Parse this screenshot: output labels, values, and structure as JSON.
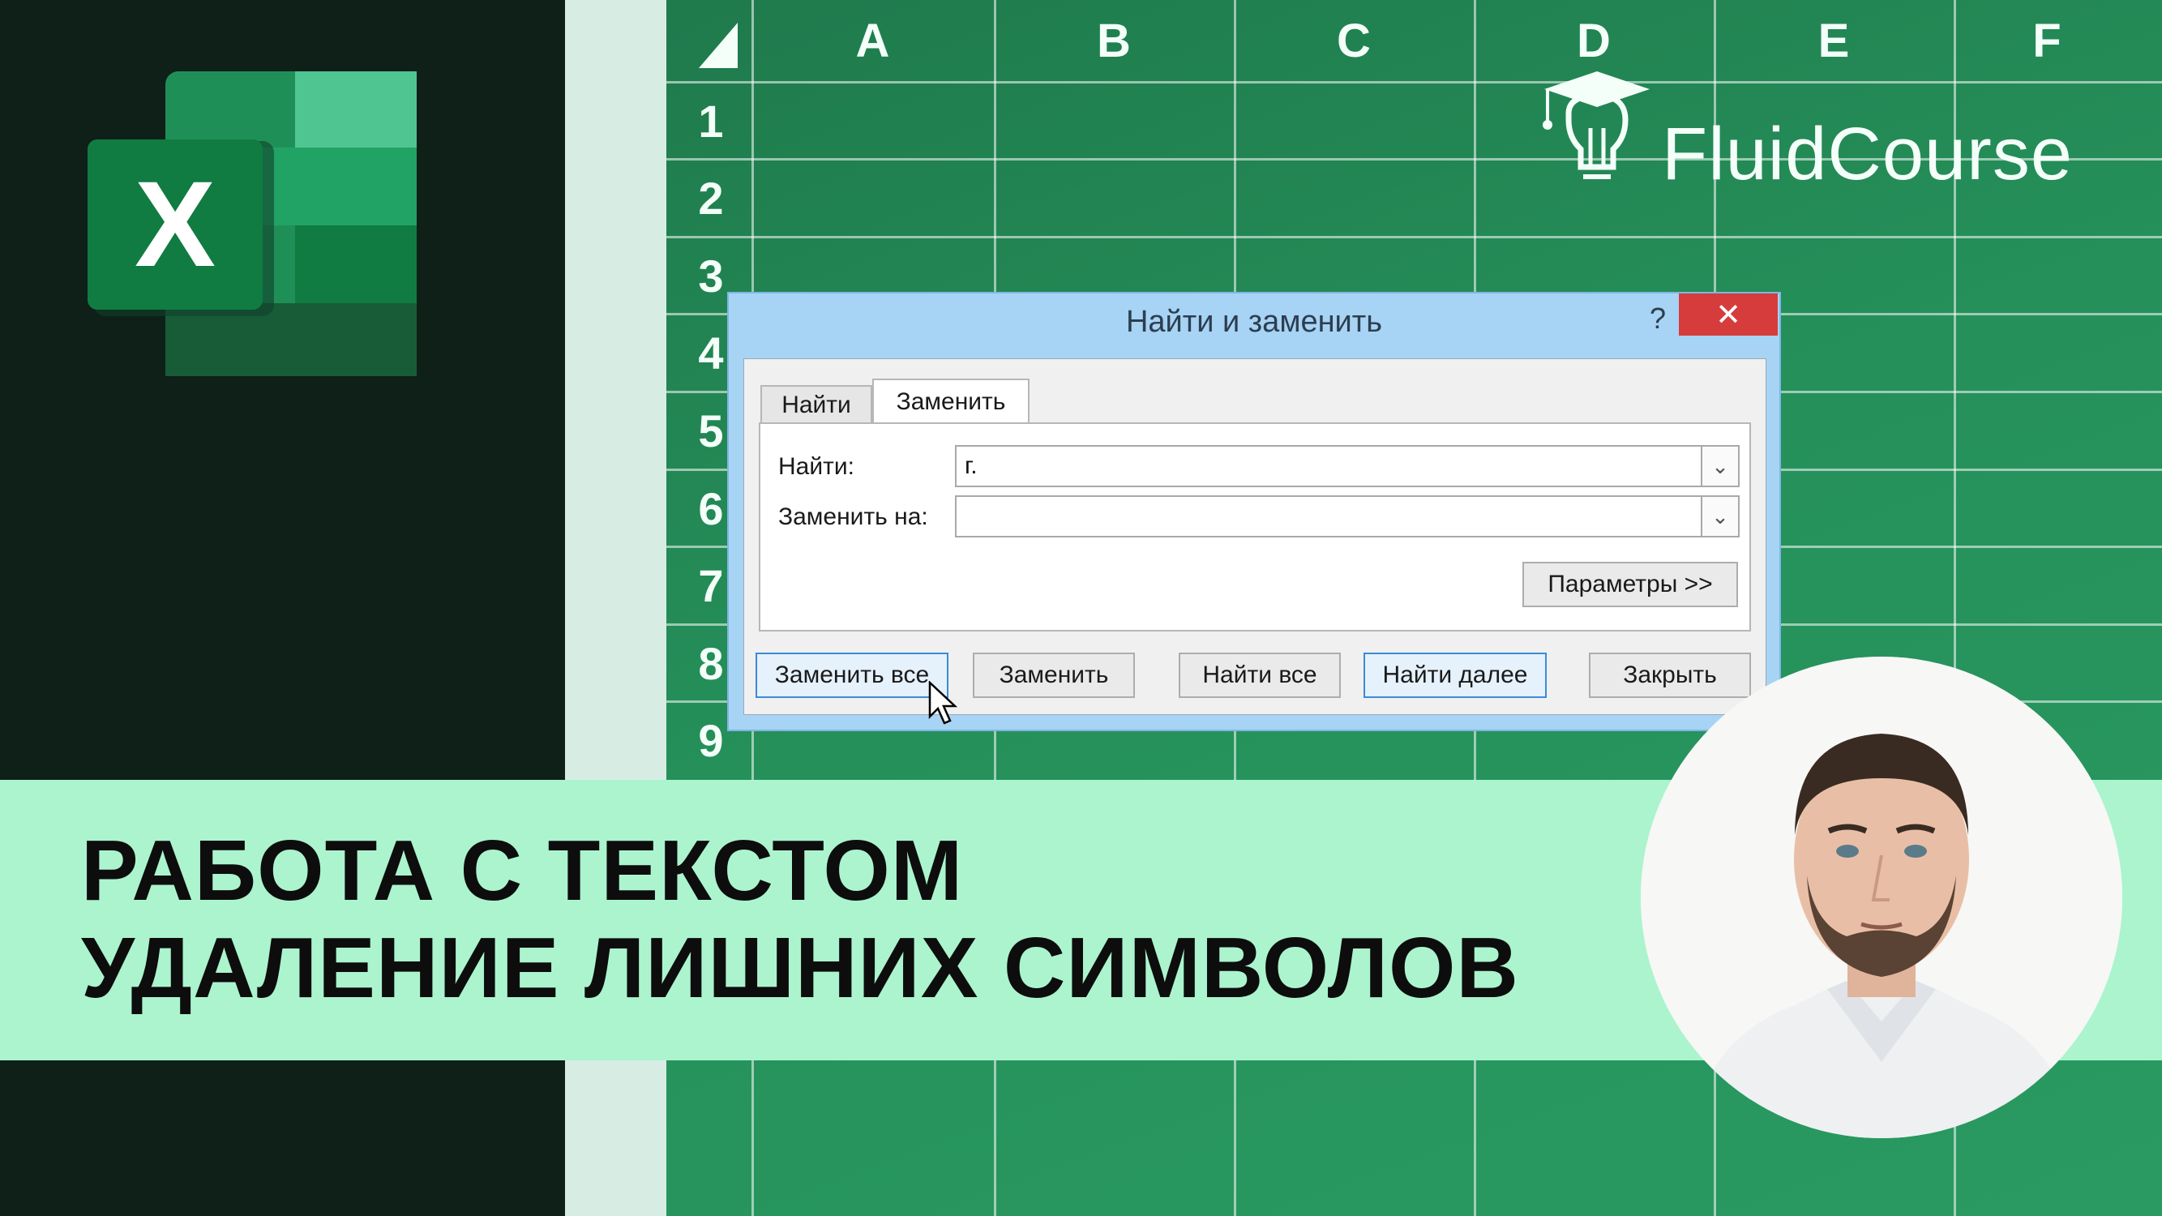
{
  "sheet": {
    "columns": [
      "A",
      "B",
      "C",
      "D",
      "E",
      "F"
    ],
    "rows": [
      "1",
      "2",
      "3",
      "4",
      "5",
      "6",
      "7",
      "8",
      "9"
    ]
  },
  "brand": {
    "name": "FluidCourse"
  },
  "excel_logo": {
    "letter": "X"
  },
  "dialog": {
    "title": "Найти и заменить",
    "help": "?",
    "close": "✕",
    "tabs": [
      "Найти",
      "Заменить"
    ],
    "active_tab": "Заменить",
    "find_label": "Найти:",
    "find_value": "г.",
    "replace_label": "Заменить на:",
    "replace_value": "",
    "options_button": "Параметры >>",
    "buttons": {
      "replace_all": "Заменить все",
      "replace": "Заменить",
      "find_all": "Найти все",
      "find_next": "Найти далее",
      "close": "Закрыть"
    }
  },
  "banner": {
    "line1": "РАБОТА С ТЕКСТОМ",
    "line2": "УДАЛЕНИЕ ЛИШНИХ СИМВОЛОВ"
  },
  "colors": {
    "sheet_green": "#25905a",
    "banner_mint": "#abf4ce",
    "dialog_frame": "#a7d3f5",
    "close_red": "#d63c3c"
  }
}
